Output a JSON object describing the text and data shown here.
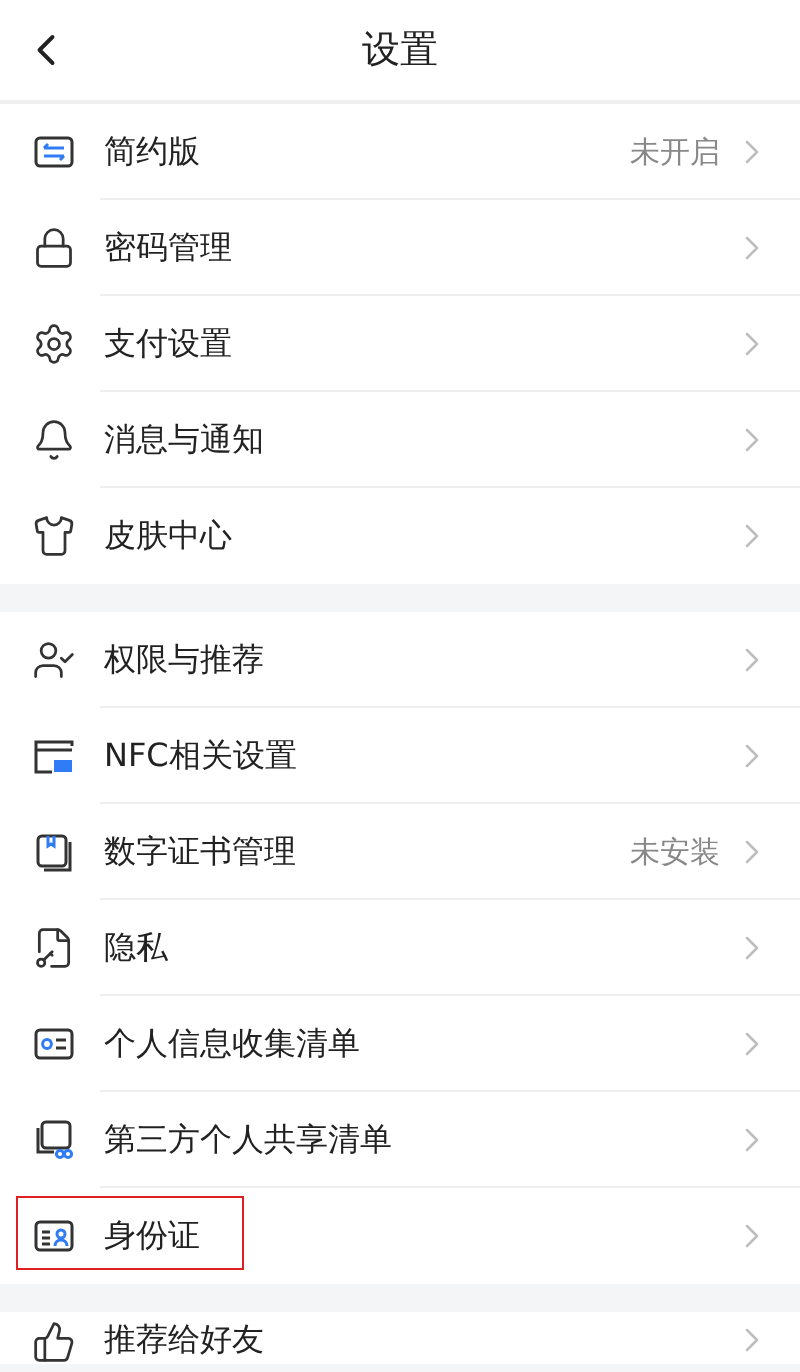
{
  "header": {
    "title": "设置"
  },
  "groups": [
    {
      "items": [
        {
          "label": "简约版",
          "value": "未开启",
          "highlighted": false
        },
        {
          "label": "密码管理",
          "highlighted": false
        },
        {
          "label": "支付设置",
          "highlighted": false
        },
        {
          "label": "消息与通知",
          "highlighted": false
        },
        {
          "label": "皮肤中心",
          "highlighted": false
        }
      ]
    },
    {
      "items": [
        {
          "label": "权限与推荐",
          "highlighted": false
        },
        {
          "label": "NFC相关设置",
          "highlighted": false
        },
        {
          "label": "数字证书管理",
          "value": "未安装",
          "highlighted": false
        },
        {
          "label": "隐私",
          "highlighted": false
        },
        {
          "label": "个人信息收集清单",
          "highlighted": false
        },
        {
          "label": "第三方个人共享清单",
          "highlighted": false
        },
        {
          "label": "身份证",
          "highlighted": true
        }
      ]
    },
    {
      "items": [
        {
          "label": "推荐给好友",
          "highlighted": false
        }
      ]
    }
  ]
}
